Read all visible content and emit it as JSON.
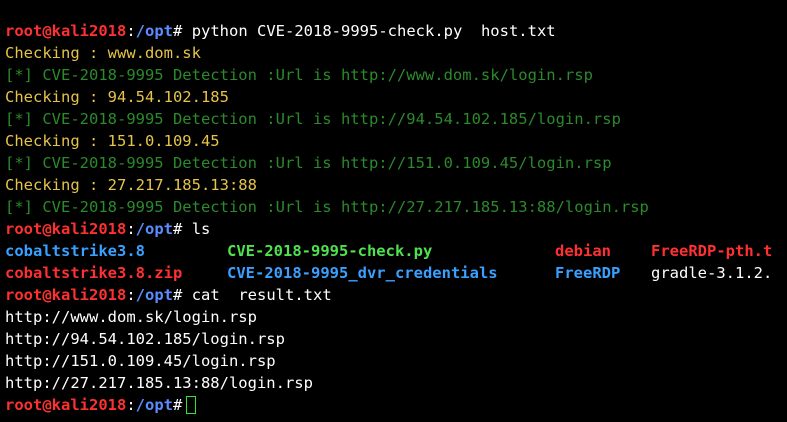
{
  "prompt": {
    "user_host": "root@kali2018",
    "separator": ":",
    "path": "/opt",
    "symbol": "#"
  },
  "commands": {
    "cmd1": "python CVE-2018-9995-check.py  host.txt",
    "cmd2": "ls",
    "cmd3": "cat  result.txt"
  },
  "check_output": [
    {
      "checking": "Checking : www.dom.sk",
      "detection": "[*] CVE-2018-9995 Detection :Url is http://www.dom.sk/login.rsp"
    },
    {
      "checking": "Checking : 94.54.102.185",
      "detection": "[*] CVE-2018-9995 Detection :Url is http://94.54.102.185/login.rsp"
    },
    {
      "checking": "Checking : 151.0.109.45",
      "detection": "[*] CVE-2018-9995 Detection :Url is http://151.0.109.45/login.rsp"
    },
    {
      "checking": "Checking : 27.217.185.13:88",
      "detection": "[*] CVE-2018-9995 Detection :Url is http://27.217.185.13:88/login.rsp"
    }
  ],
  "ls_output": {
    "row1": [
      "cobaltstrike3.8",
      "CVE-2018-9995-check.py",
      "debian",
      "FreeRDP-pth.t"
    ],
    "row2": [
      "cobaltstrike3.8.zip",
      "CVE-2018-9995_dvr_credentials",
      "FreeRDP",
      "gradle-3.1.2."
    ]
  },
  "cat_output": [
    "http://www.dom.sk/login.rsp",
    "http://94.54.102.185/login.rsp",
    "http://151.0.109.45/login.rsp",
    "http://27.217.185.13:88/login.rsp"
  ],
  "colors": {
    "background": "#000000",
    "prompt_user": "#ff3030",
    "prompt_path": "#5b8cff",
    "checking": "#e6c34a",
    "detection": "#2b8a2b",
    "directory": "#3aa0ff",
    "executable": "#4fe14f",
    "cursor": "#2ee82e"
  }
}
